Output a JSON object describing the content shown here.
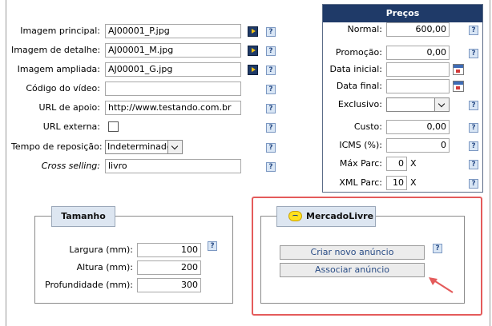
{
  "product": {
    "imagem_principal": {
      "label": "Imagem principal:",
      "value": "AJ00001_P.jpg"
    },
    "imagem_detalhe": {
      "label": "Imagem de detalhe:",
      "value": "AJ00001_M.jpg"
    },
    "imagem_ampliada": {
      "label": "Imagem ampliada:",
      "value": "AJ00001_G.jpg"
    },
    "codigo_video": {
      "label": "Código do vídeo:",
      "value": ""
    },
    "url_apoio": {
      "label": "URL de apoio:",
      "value": "http://www.testando.com.br"
    },
    "url_externa": {
      "label": "URL externa:"
    },
    "tempo_reposicao": {
      "label": "Tempo de reposição:",
      "value": "Indeterminado"
    },
    "cross_selling": {
      "label": "Cross selling:",
      "value": "livro"
    }
  },
  "help_label": "?",
  "precos": {
    "title": "Preços",
    "normal": {
      "label": "Normal:",
      "value": "600,00"
    },
    "promocao": {
      "label": "Promoção:",
      "value": "0,00"
    },
    "data_inicial": {
      "label": "Data inicial:",
      "value": ""
    },
    "data_final": {
      "label": "Data final:",
      "value": ""
    },
    "exclusivo": {
      "label": "Exclusivo:",
      "value": ""
    },
    "custo": {
      "label": "Custo:",
      "value": "0,00"
    },
    "icms": {
      "label": "ICMS (%):",
      "value": "0"
    },
    "max_parc": {
      "label": "Máx Parc:",
      "value": "0",
      "suffix": "X"
    },
    "xml_parc": {
      "label": "XML Parc:",
      "value": "10",
      "suffix": "X"
    }
  },
  "tamanho": {
    "title": "Tamanho",
    "largura": {
      "label": "Largura (mm):",
      "value": "100"
    },
    "altura": {
      "label": "Altura (mm):",
      "value": "200"
    },
    "profundidade": {
      "label": "Profundidade (mm):",
      "value": "300"
    }
  },
  "mercadolivre": {
    "title": "MercadoLivre",
    "criar_label": "Criar novo anúncio",
    "associar_label": "Associar anúncio"
  },
  "colors": {
    "header_bg": "#1f3a68",
    "highlight": "#e45b5b",
    "link_text": "#2a4d86"
  }
}
